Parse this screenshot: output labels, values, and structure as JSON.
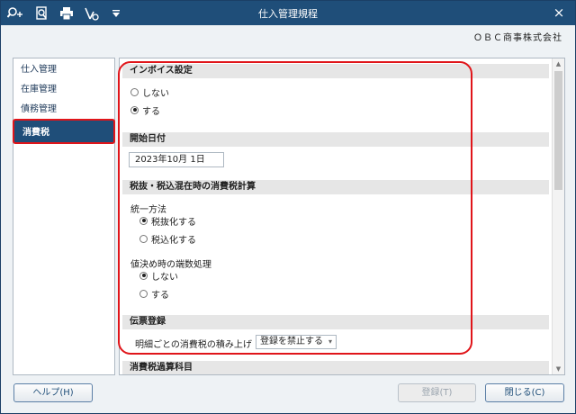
{
  "window": {
    "title": "仕入管理規程",
    "company": "ＯＢＣ商事株式会社",
    "close_glyph": "×",
    "toolbar_icons": [
      "search-plus-icon",
      "search-doc-icon",
      "printer-icon",
      "check-doc-icon",
      "dropdown-icon"
    ]
  },
  "sidebar": {
    "items": [
      {
        "label": "仕入管理",
        "active": false
      },
      {
        "label": "在庫管理",
        "active": false
      },
      {
        "label": "債務管理",
        "active": false
      },
      {
        "label": "消費税",
        "active": true
      }
    ]
  },
  "main": {
    "invoice": {
      "heading": "インボイス設定",
      "options": [
        {
          "label": "しない",
          "selected": false
        },
        {
          "label": "する",
          "selected": true
        }
      ]
    },
    "start_date": {
      "heading": "開始日付",
      "value": "2023年10月  1日"
    },
    "calc": {
      "heading": "税抜・税込混在時の消費税計算",
      "unify_label": "統一方法",
      "unify_options": [
        {
          "label": "税抜化する",
          "selected": true
        },
        {
          "label": "税込化する",
          "selected": false
        }
      ],
      "rounding_label": "値決め時の端数処理",
      "rounding_options": [
        {
          "label": "しない",
          "selected": true
        },
        {
          "label": "する",
          "selected": false
        }
      ]
    },
    "slip": {
      "heading": "伝票登録",
      "row_label": "明細ごとの消費税の積み上げ",
      "select_value": "登録を禁止する"
    },
    "next_heading": "消費税過算科目"
  },
  "footer": {
    "help_label": "ヘルプ(H)",
    "register_label": "登録(T)",
    "close_label": "閉じる(C)"
  },
  "colors": {
    "titlebar": "#1f4e79",
    "highlight": "#e0151a",
    "active_item": "#1f4e79"
  }
}
